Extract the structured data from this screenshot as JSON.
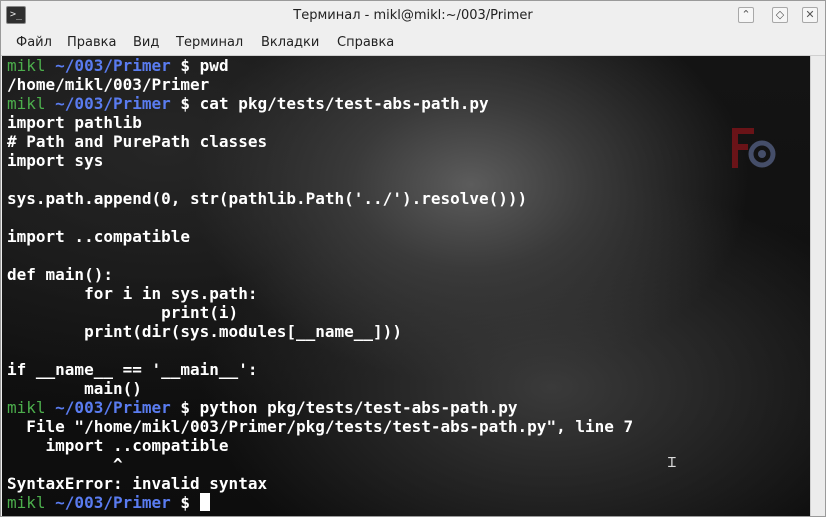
{
  "window": {
    "title": "Терминал - mikl@mikl:~/003/Primer",
    "icon_glyph": ">_",
    "buttons": {
      "minimize": "⌃",
      "maximize": "◇",
      "close": "✕"
    }
  },
  "menu": [
    "Файл",
    "Правка",
    "Вид",
    "Терминал",
    "Вкладки",
    "Справка"
  ],
  "colors": {
    "prompt_user": "#4cae4c",
    "prompt_path": "#5a7cf0",
    "text": "#ffffff",
    "background": "#111111"
  },
  "prompt": {
    "user": "mikl",
    "path": "~/003/Primer",
    "symbol": "$"
  },
  "terminal_lines": [
    {
      "type": "prompt",
      "cmd": "pwd"
    },
    {
      "type": "out",
      "text": "/home/mikl/003/Primer"
    },
    {
      "type": "prompt",
      "cmd": "cat pkg/tests/test-abs-path.py"
    },
    {
      "type": "out",
      "text": "import pathlib"
    },
    {
      "type": "out",
      "text": "# Path and PurePath classes"
    },
    {
      "type": "out",
      "text": "import sys"
    },
    {
      "type": "out",
      "text": ""
    },
    {
      "type": "out",
      "text": "sys.path.append(0, str(pathlib.Path('../').resolve()))"
    },
    {
      "type": "out",
      "text": ""
    },
    {
      "type": "out",
      "text": "import ..compatible"
    },
    {
      "type": "out",
      "text": ""
    },
    {
      "type": "out",
      "text": "def main():"
    },
    {
      "type": "out",
      "text": "        for i in sys.path:"
    },
    {
      "type": "out",
      "text": "                print(i)"
    },
    {
      "type": "out",
      "text": "        print(dir(sys.modules[__name__]))"
    },
    {
      "type": "out",
      "text": ""
    },
    {
      "type": "out",
      "text": "if __name__ == '__main__':"
    },
    {
      "type": "out",
      "text": "        main()"
    },
    {
      "type": "prompt",
      "cmd": "python pkg/tests/test-abs-path.py"
    },
    {
      "type": "out",
      "text": "  File \"/home/mikl/003/Primer/pkg/tests/test-abs-path.py\", line 7"
    },
    {
      "type": "out",
      "text": "    import ..compatible"
    },
    {
      "type": "out",
      "text": "           ^"
    },
    {
      "type": "out",
      "text": "SyntaxError: invalid syntax"
    },
    {
      "type": "prompt",
      "cmd": "",
      "cursor": true
    }
  ]
}
